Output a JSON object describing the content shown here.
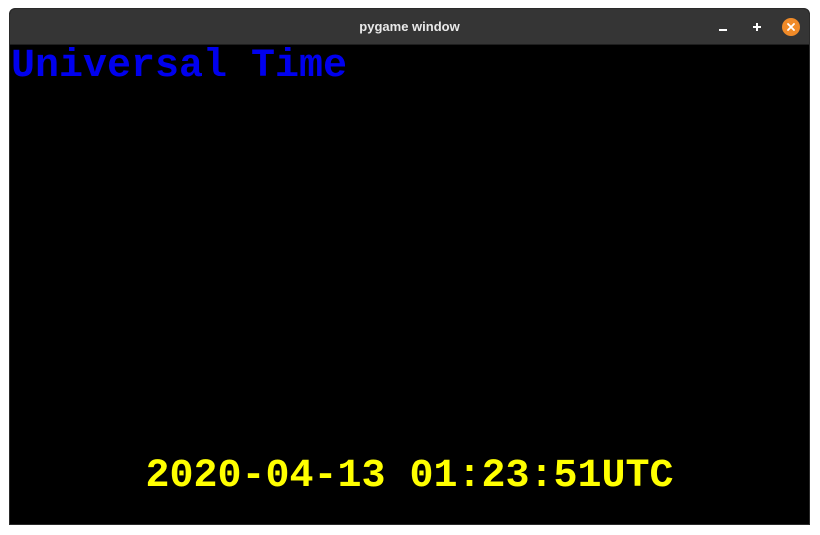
{
  "window": {
    "title": "pygame window"
  },
  "controls": {
    "minimize_icon": "minimize-icon",
    "maximize_icon": "maximize-icon",
    "close_icon": "close-icon"
  },
  "screen": {
    "heading": "Universal Time",
    "time": "2020-04-13 01:23:51UTC"
  },
  "colors": {
    "background": "#000000",
    "heading": "#0000ee",
    "time": "#ffff00",
    "titlebar": "#353535",
    "close_button": "#f08a28"
  }
}
